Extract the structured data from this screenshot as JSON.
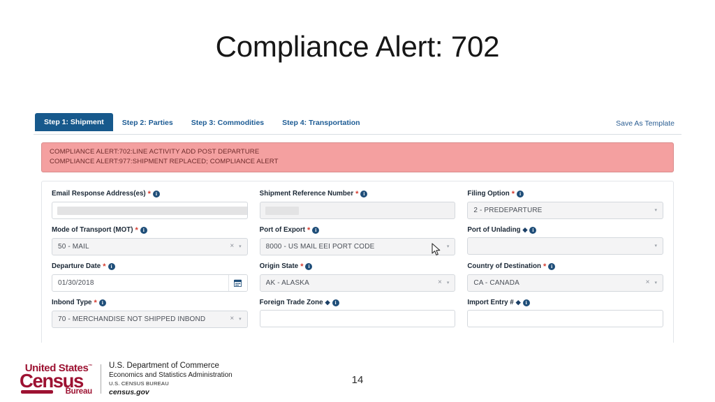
{
  "slide": {
    "title": "Compliance Alert: 702",
    "page_number": "14"
  },
  "app": {
    "tabs": [
      {
        "label": "Step 1: Shipment",
        "active": true
      },
      {
        "label": "Step 2: Parties",
        "active": false
      },
      {
        "label": "Step 3: Commodities",
        "active": false
      },
      {
        "label": "Step 4: Transportation",
        "active": false
      }
    ],
    "save_as_template": "Save As Template",
    "alert": {
      "lines": [
        "COMPLIANCE ALERT:702:LINE ACTIVITY ADD POST DEPARTURE",
        "COMPLIANCE ALERT:977:SHIPMENT REPLACED; COMPLIANCE ALERT"
      ],
      "background_color": "#f4a0a0",
      "text_color": "#6e2b2b"
    },
    "form": {
      "rows": [
        [
          {
            "label": "Email Response Address(es)",
            "marker": "*",
            "info": "i",
            "type": "redacted-input",
            "value": "",
            "redacted_width": 280
          },
          {
            "label": "Shipment Reference Number",
            "marker": "*",
            "info": "i",
            "type": "redacted-input",
            "value": "",
            "redacted_width": 48,
            "disabled": true
          },
          {
            "label": "Filing Option",
            "marker": "*",
            "info": "i",
            "type": "select",
            "value": "2 - PREDEPARTURE",
            "clearable": false
          }
        ],
        [
          {
            "label": "Mode of Transport (MOT)",
            "marker": "*",
            "info": "i",
            "type": "select",
            "value": "50 - MAIL",
            "clearable": true
          },
          {
            "label": "Port of Export",
            "marker": "*",
            "info": "i",
            "type": "select",
            "value": "8000 - US MAIL EEI PORT CODE",
            "clearable": false
          },
          {
            "label": "Port of Unlading",
            "marker": "◆",
            "info": "i",
            "type": "select",
            "value": "",
            "clearable": false
          }
        ],
        [
          {
            "label": "Departure Date",
            "marker": "*",
            "info": "i",
            "type": "date",
            "value": "01/30/2018"
          },
          {
            "label": "Origin State",
            "marker": "*",
            "info": "i",
            "type": "select",
            "value": "AK - ALASKA",
            "clearable": true
          },
          {
            "label": "Country of Destination",
            "marker": "*",
            "info": "i",
            "type": "select",
            "value": "CA - CANADA",
            "clearable": true
          }
        ],
        [
          {
            "label": "Inbond Type",
            "marker": "*",
            "info": "i",
            "type": "select",
            "value": "70 - MERCHANDISE NOT SHIPPED INBOND",
            "clearable": true
          },
          {
            "label": "Foreign Trade Zone",
            "marker": "◆",
            "info": "i",
            "type": "text",
            "value": ""
          },
          {
            "label": "Import Entry #",
            "marker": "◆",
            "info": "i",
            "type": "text",
            "value": ""
          }
        ]
      ],
      "clear_glyph": "×",
      "caret_glyph": "▾"
    }
  },
  "footer": {
    "logo": {
      "united_states": "United States",
      "trademark": "™",
      "census": "Census",
      "bureau": "Bureau"
    },
    "agency_lines": [
      "U.S. Department of Commerce",
      "Economics and Statistics Administration",
      "U.S. CENSUS BUREAU",
      "census.gov"
    ],
    "brand_color": "#9d1232"
  }
}
